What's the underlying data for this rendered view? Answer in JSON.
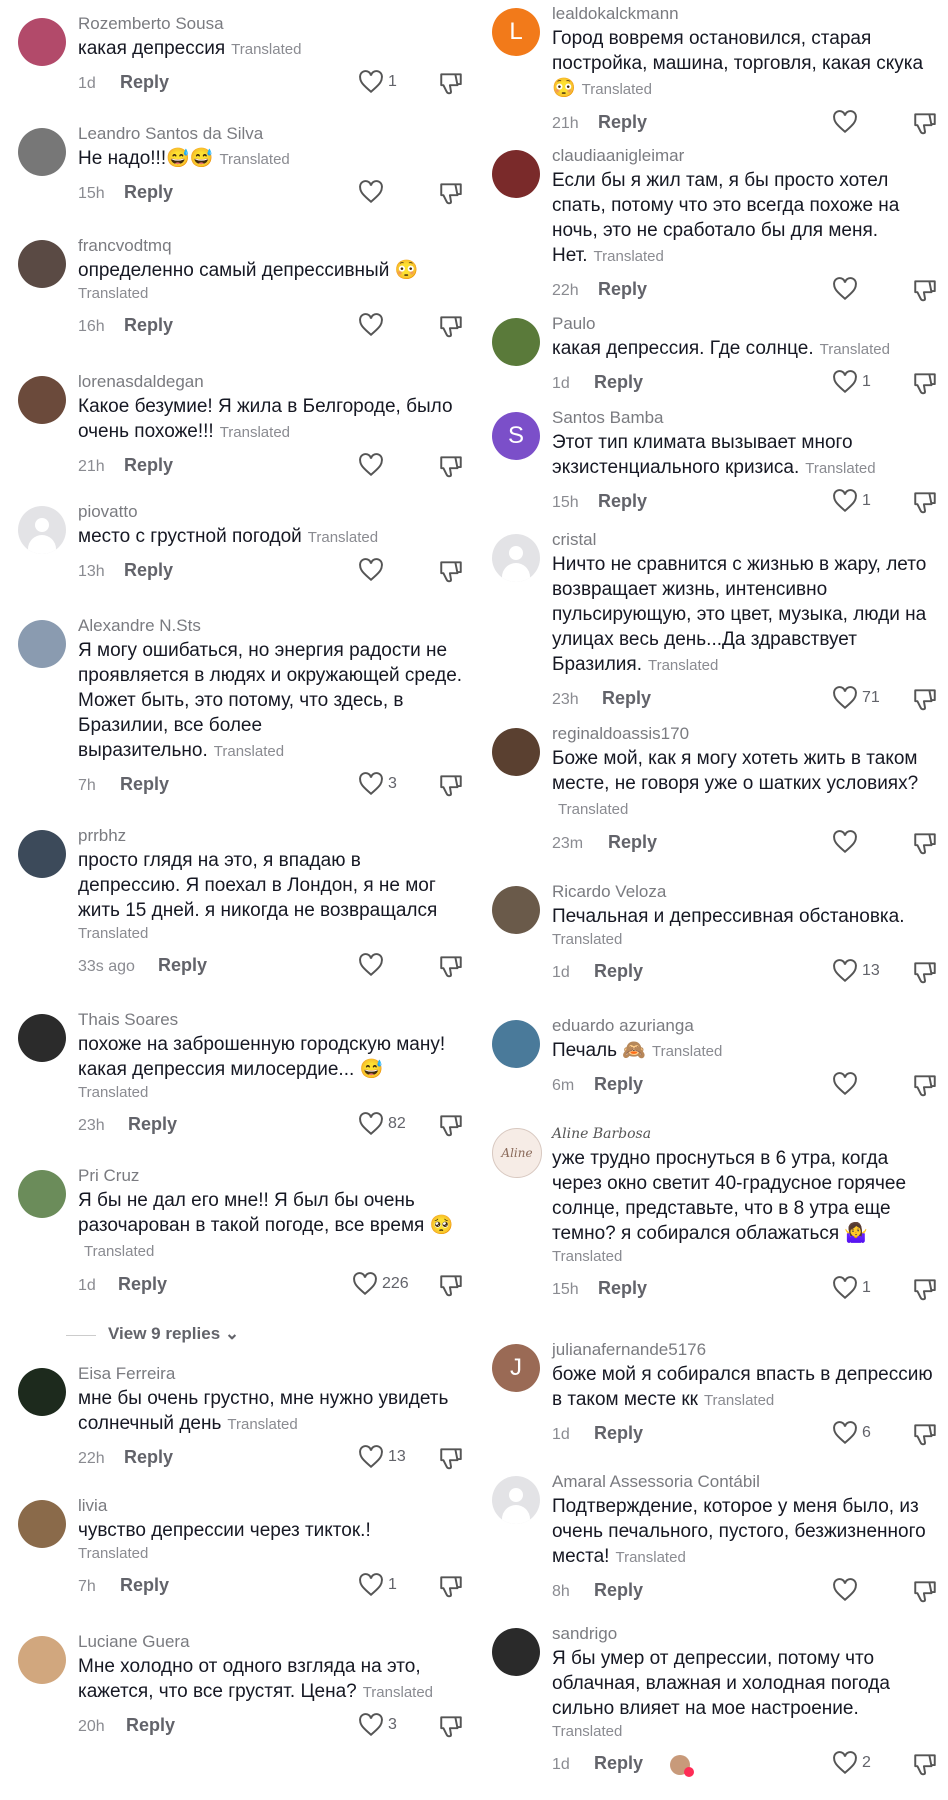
{
  "labels": {
    "translated": "Translated",
    "reply": "Reply",
    "view_replies": "View 9 replies"
  },
  "comments_left": [
    {
      "username": "Rozemberto Sousa",
      "text": "какая депрессия",
      "time": "1d",
      "likes": "1",
      "avatar": "photo",
      "avatar_color": "#b24a6a"
    },
    {
      "username": "Leandro Santos da Silva",
      "text": "Не надо!!!😅😅",
      "time": "15h",
      "likes": "",
      "avatar": "photo",
      "avatar_color": "#777777"
    },
    {
      "username": "francvodtmq",
      "text": "определенно самый депрессивный 😳",
      "time": "16h",
      "likes": "",
      "avatar": "photo",
      "avatar_color": "#5a4a44"
    },
    {
      "username": "lorenasdaldegan",
      "text": "Какое безумие! Я жила в Белгороде, было очень похоже!!!",
      "time": "21h",
      "likes": "",
      "avatar": "photo",
      "avatar_color": "#6b4a3b"
    },
    {
      "username": "piovatto",
      "text": "место с грустной погодой",
      "time": "13h",
      "likes": "",
      "avatar": "placeholder"
    },
    {
      "username": "Alexandre N.Sts",
      "text": "Я могу ошибаться, но энергия радости не проявляется в людях и окружающей среде. Может быть, это потому, что здесь, в Бразилии, все более выразительно.",
      "time": "7h",
      "likes": "3",
      "avatar": "photo",
      "avatar_color": "#8a9bb0"
    },
    {
      "username": "prrbhz",
      "text": "просто глядя на это, я впадаю в депрессию. Я поехал в Лондон, я не мог жить 15 дней. я никогда не возвращался",
      "time": "33s ago",
      "likes": "",
      "avatar": "photo",
      "avatar_color": "#3c4a5a"
    },
    {
      "username": "Thais Soares",
      "text": "похоже на заброшенную городскую ману! какая депрессия милосердие... 😅",
      "time": "23h",
      "likes": "82",
      "avatar": "photo",
      "avatar_color": "#2b2b2b"
    },
    {
      "username": "Pri Cruz",
      "text": "Я бы не дал его мне!! Я был бы очень разочарован в такой погоде, все время 🥺",
      "time": "1d",
      "likes": "226",
      "avatar": "photo",
      "avatar_color": "#6b8c5a"
    },
    {
      "username": "Eisa Ferreira",
      "text": "мне бы очень грустно, мне нужно увидеть солнечный день",
      "time": "22h",
      "likes": "13",
      "avatar": "photo",
      "avatar_color": "#1d2a1d"
    },
    {
      "username": "livia",
      "text": "чувство депрессии через тикток.!",
      "time": "7h",
      "likes": "1",
      "avatar": "photo",
      "avatar_color": "#8a6a4a"
    },
    {
      "username": "Luciane Guera",
      "text": "Мне холодно от одного взгляда на это, кажется, что все грустят. Цена?",
      "time": "20h",
      "likes": "3",
      "avatar": "photo",
      "avatar_color": "#d1a77e"
    }
  ],
  "comments_right": [
    {
      "username": "lealdokalckmann",
      "text": "Город вовремя остановился, старая постройка, машина, торговля, какая скука 😳",
      "time": "21h",
      "likes": "",
      "avatar": "letter",
      "letter": "L"
    },
    {
      "username": "claudiaanigleimar",
      "text": "Если бы я жил там, я бы просто хотел спать, потому что это всегда похоже на ночь, это не сработало бы для меня. Нет.",
      "time": "22h",
      "likes": "",
      "avatar": "photo",
      "avatar_color": "#7a2a2a"
    },
    {
      "username": "Paulo",
      "text": "какая депрессия. Где солнце.",
      "time": "1d",
      "likes": "1",
      "avatar": "photo",
      "avatar_color": "#5a7a3a"
    },
    {
      "username": "Santos Bamba",
      "text": "Этот тип климата вызывает много экзистенциального кризиса.",
      "time": "15h",
      "likes": "1",
      "avatar": "letter",
      "letter": "S"
    },
    {
      "username": "cristal",
      "text": "Ничто не сравнится с жизнью в жару, лето возвращает жизнь, интенсивно пульсирующую, это цвет, музыка, люди на улицах весь день...Да здравствует Бразилия.",
      "time": "23h",
      "likes": "71",
      "avatar": "placeholder"
    },
    {
      "username": "reginaldoassis170",
      "text": "Боже мой, как я могу хотеть жить в таком месте, не говоря уже о шатких условиях?",
      "time": "23m",
      "likes": "",
      "avatar": "photo",
      "avatar_color": "#5a4030"
    },
    {
      "username": "Ricardo Veloza",
      "text": "Печальная и депрессивная обстановка.",
      "time": "1d",
      "likes": "13",
      "avatar": "photo",
      "avatar_color": "#6a5a4a"
    },
    {
      "username": "eduardo azurianga",
      "text": "Печаль 🙈",
      "time": "6m",
      "likes": "",
      "avatar": "photo",
      "avatar_color": "#4a7a9a"
    },
    {
      "username": "Aline Barbosa",
      "text": "уже трудно проснуться в 6 утра, когда через окно светит 40-градусное горячее солнце, представьте, что в 8 утра еще темно? я собирался облажаться 🤷‍♀️",
      "time": "15h",
      "likes": "1",
      "avatar": "logo"
    },
    {
      "username": "julianafernande5176",
      "text": "боже мой я собирался впасть в депрессию в таком месте кк",
      "time": "1d",
      "likes": "6",
      "avatar": "letter",
      "letter": "J"
    },
    {
      "username": "Amaral Assessoria Contábil",
      "text": "Подтверждение, которое у меня было, из очень печального, пустого, безжизненного места!",
      "time": "8h",
      "likes": "",
      "avatar": "placeholder"
    },
    {
      "username": "sandrigo",
      "text": "Я бы умер от депрессии, потому что облачная, влажная и холодная погода сильно влияет на мое настроение.",
      "time": "1d",
      "likes": "2",
      "avatar": "photo",
      "avatar_color": "#2a2a2a"
    }
  ],
  "aline_logo_text": "Aline",
  "colors": {
    "username": "#7a7b80",
    "text": "#161823",
    "meta": "#8a8b91"
  }
}
